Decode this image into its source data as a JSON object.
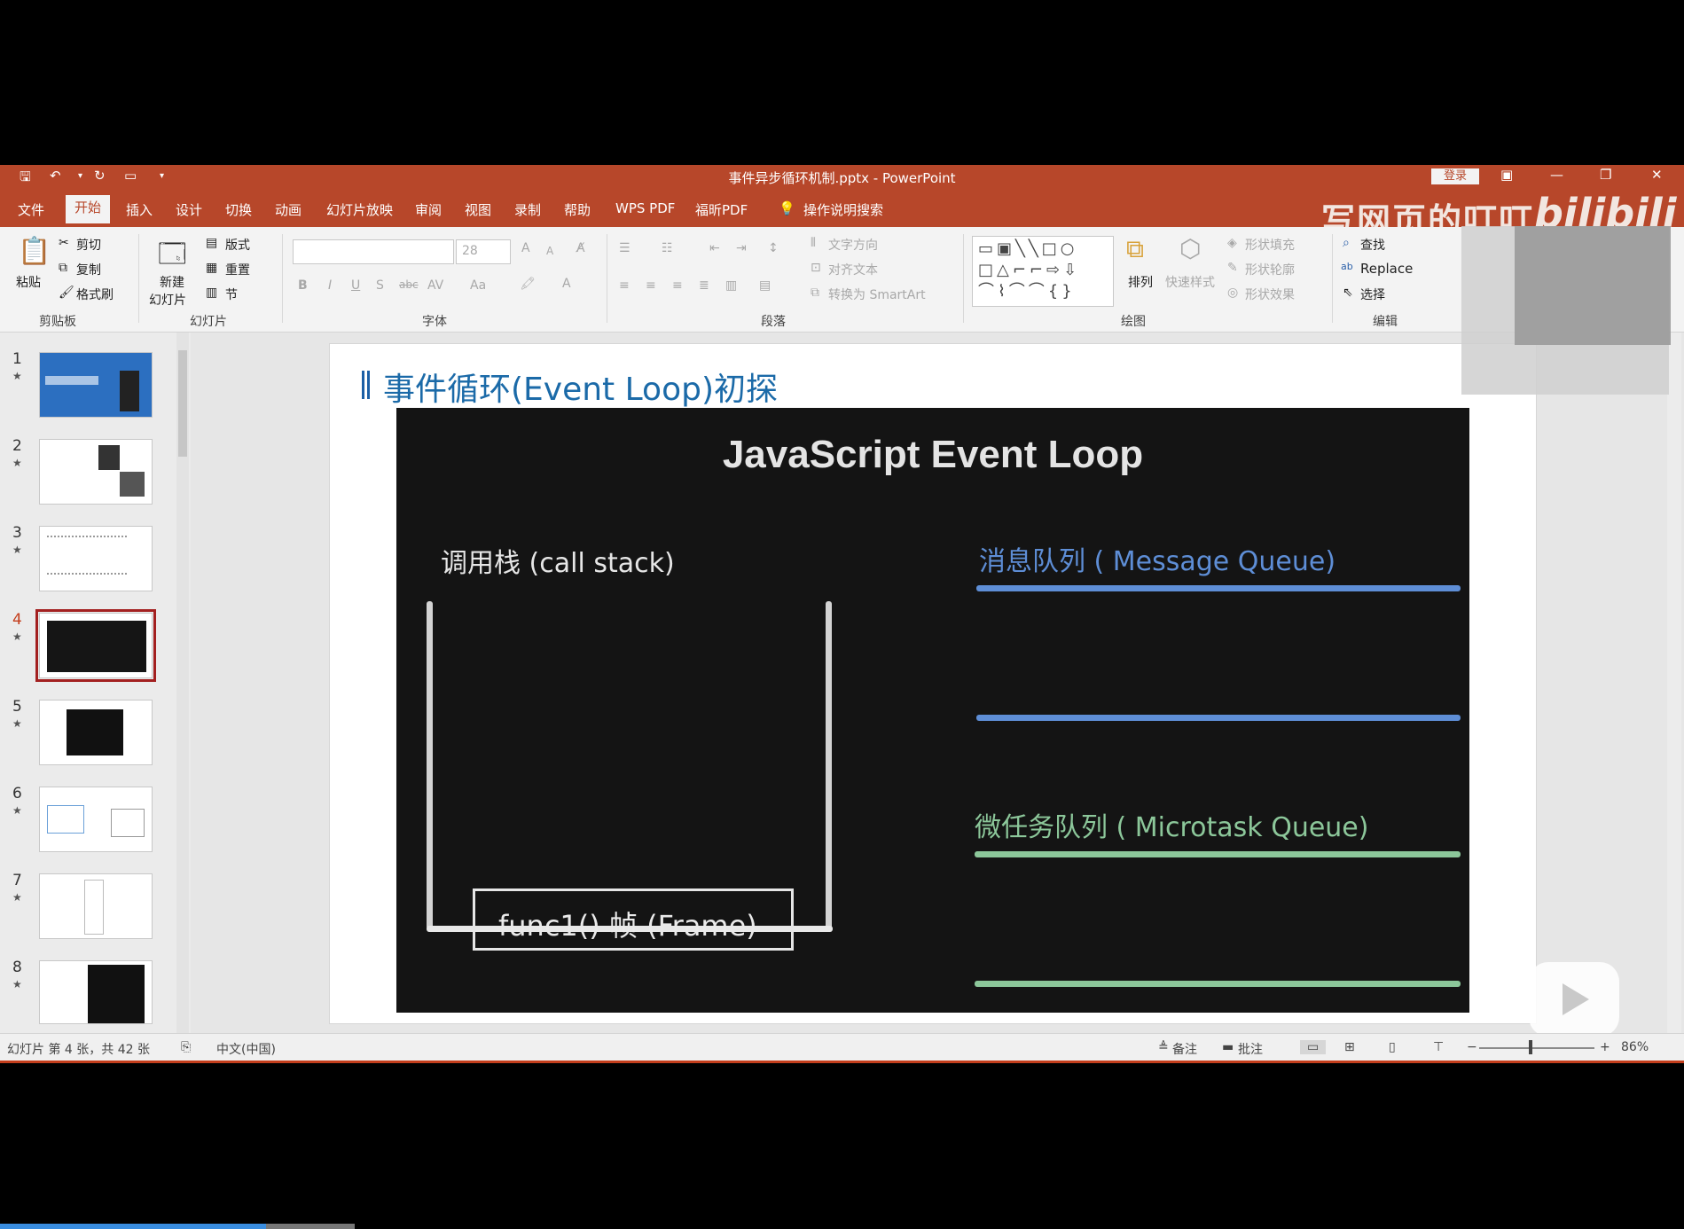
{
  "window": {
    "title": "事件异步循环机制.pptx - PowerPoint",
    "login_label": "登录"
  },
  "menu": {
    "tabs": [
      "文件",
      "开始",
      "插入",
      "设计",
      "切换",
      "动画",
      "幻灯片放映",
      "审阅",
      "视图",
      "录制",
      "帮助",
      "WPS PDF",
      "福昕PDF"
    ],
    "active_tab": "开始",
    "search_label": "操作说明搜索"
  },
  "watermark": {
    "text": "写网页的叮叮",
    "logo": "bilibili"
  },
  "ribbon": {
    "clipboard": {
      "paste": "粘贴",
      "cut": "剪切",
      "copy": "复制",
      "format_painter": "格式刷",
      "group": "剪贴板"
    },
    "slides": {
      "new_slide": "新建",
      "new_slide2": "幻灯片",
      "layout": "版式",
      "reset": "重置",
      "section": "节",
      "group": "幻灯片"
    },
    "font": {
      "size": "28",
      "bold": "B",
      "italic": "I",
      "underline": "U",
      "shadow": "S",
      "strike": "abc",
      "spacing": "AV",
      "case": "Aa",
      "color": "A",
      "grow": "A",
      "shrink": "A",
      "group": "字体"
    },
    "paragraph": {
      "text_direction": "文字方向",
      "align_text": "对齐文本",
      "smartart": "转换为 SmartArt",
      "group": "段落"
    },
    "drawing": {
      "arrange": "排列",
      "quick_styles": "快速样式",
      "shape_fill": "形状填充",
      "shape_outline": "形状轮廓",
      "shape_effects": "形状效果",
      "group": "绘图"
    },
    "editing": {
      "find": "查找",
      "replace": "Replace",
      "select": "选择",
      "group": "编辑"
    }
  },
  "thumbnails": {
    "items": [
      {
        "num": "1"
      },
      {
        "num": "2"
      },
      {
        "num": "3"
      },
      {
        "num": "4"
      },
      {
        "num": "5"
      },
      {
        "num": "6"
      },
      {
        "num": "7"
      },
      {
        "num": "8"
      }
    ],
    "star": "★",
    "selected": "4"
  },
  "slide": {
    "title": "事件循环(Event Loop)初探",
    "video": {
      "heading": "JavaScript Event Loop",
      "call_stack": "调用栈 (call stack)",
      "frame": "func1()   帧 (Frame)",
      "message_queue": "消息队列 ( Message Queue)",
      "microtask_queue": "微任务队列 ( Microtask Queue)"
    }
  },
  "statusbar": {
    "slide_info": "幻灯片 第 4 张，共 42 张",
    "language": "中文(中国)",
    "notes": "备注",
    "comments": "批注",
    "zoom": "86%"
  },
  "colors": {
    "accent": "#b7472a",
    "message_queue": "#5e8ed6",
    "microtask_queue": "#8cc79a"
  }
}
